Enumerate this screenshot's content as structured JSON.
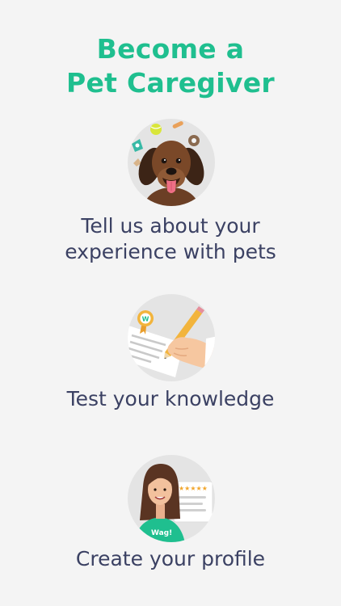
{
  "header": {
    "title_line1": "Become a",
    "title_line2": "Pet Caregiver",
    "accent_color": "#1fbf8f"
  },
  "steps": [
    {
      "icon": "dog-with-toys-icon",
      "line1": "Tell us about your",
      "line2": "experience with pets"
    },
    {
      "icon": "hand-writing-test-icon",
      "line1": "Test your knowledge"
    },
    {
      "icon": "caregiver-profile-icon",
      "line1": "Create your profile",
      "shirt_text": "Wag!",
      "rating": 5
    }
  ],
  "text_color": "#3b4163"
}
